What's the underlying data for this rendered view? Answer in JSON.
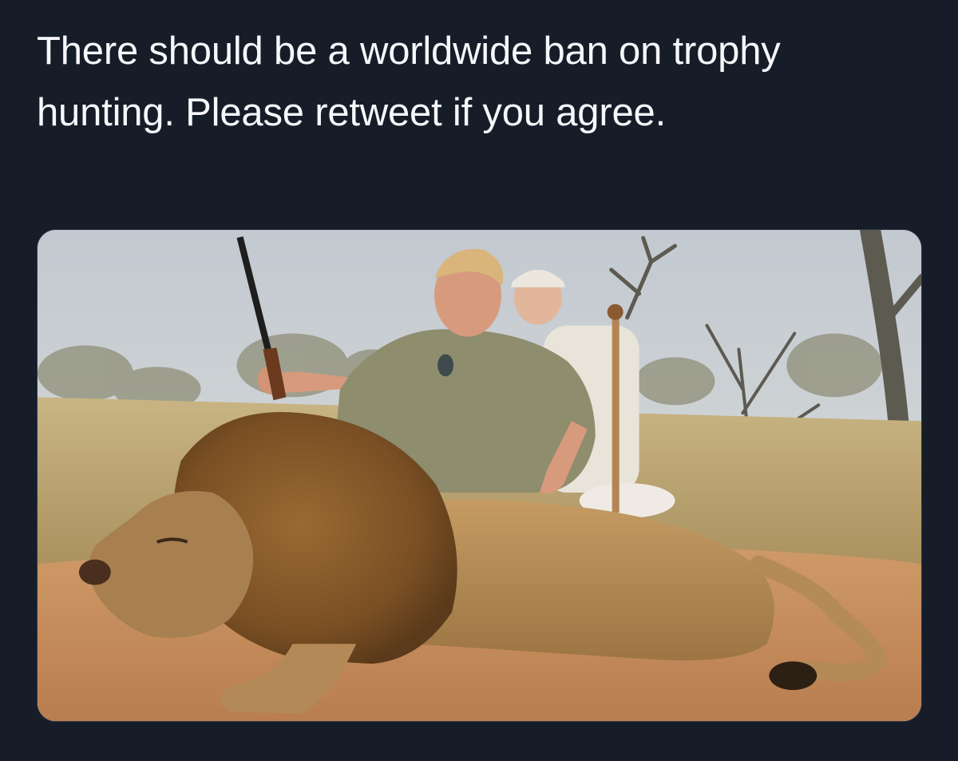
{
  "tweet": {
    "text": "There should be a worldwide ban on trophy hunting. Please retweet if you agree."
  },
  "colors": {
    "background": "#161d29",
    "text": "#f5f7fa",
    "media_border": "#2e3846"
  }
}
